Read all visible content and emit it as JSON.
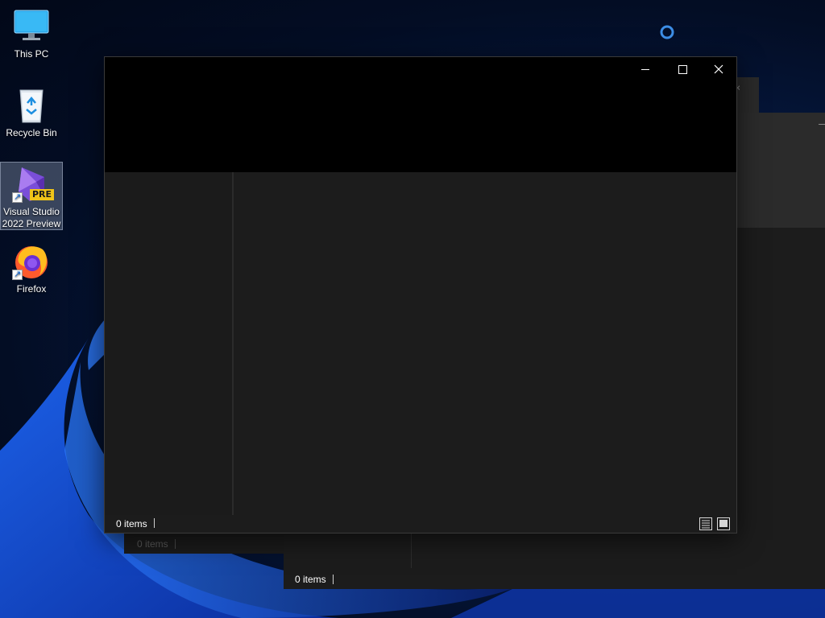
{
  "desktop": {
    "icons": [
      {
        "label": "This PC",
        "icon": "monitor-icon"
      },
      {
        "label": "Recycle Bin",
        "icon": "recycle-bin-icon"
      },
      {
        "label": "Visual Studio 2022 Preview",
        "icon": "visual-studio-icon",
        "badge": "PRE",
        "selected": true
      },
      {
        "label": "Firefox",
        "icon": "firefox-icon"
      }
    ]
  },
  "background_window_1": {
    "status": "0 items"
  },
  "background_window_2": {
    "status": "0 items"
  },
  "main_window": {
    "status": "0 items",
    "controls": {
      "minimize": "minimize-icon",
      "maximize": "maximize-icon",
      "close": "close-icon"
    },
    "view_buttons": [
      "details-view-icon",
      "large-icons-view-icon"
    ]
  },
  "colors": {
    "titlebar": "#000000",
    "window_bg": "#1c1c1c",
    "wallpaper_accent": "#1e5bff",
    "busy_ring": "#3d8ee6"
  }
}
